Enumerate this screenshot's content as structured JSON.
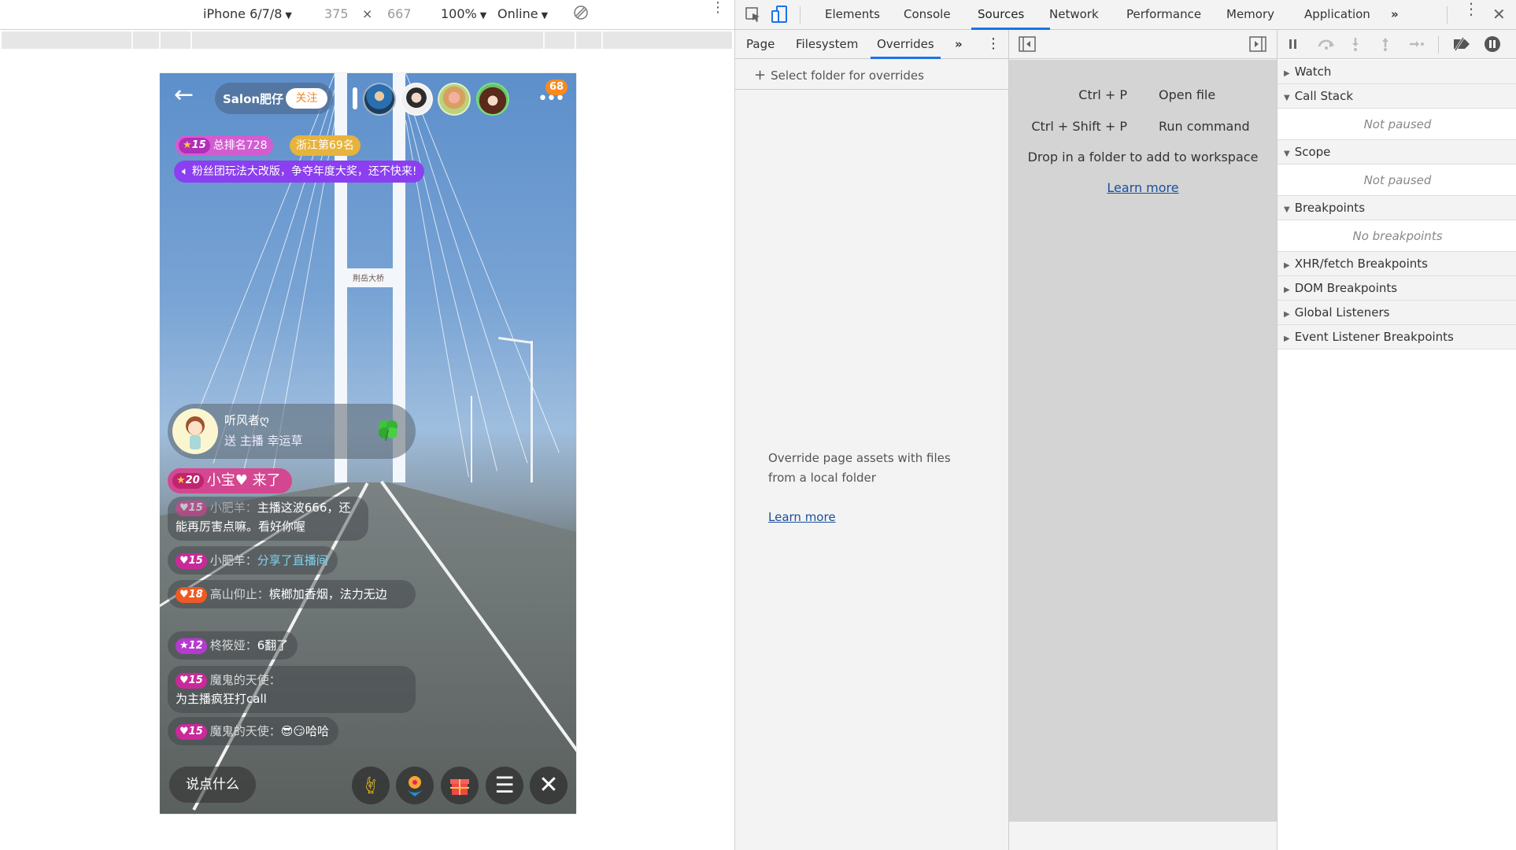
{
  "device_toolbar": {
    "device": "iPhone 6/7/8",
    "width": "375",
    "times": "×",
    "height": "667",
    "zoom": "100%",
    "network": "Online"
  },
  "phone": {
    "anchor_name": "Salon肥仔",
    "follow_label": "关注",
    "viewer_count": "68",
    "more_icon": "•••",
    "rank": {
      "level": "15",
      "text": "总排名728"
    },
    "region_rank": "浙江第69名",
    "notice": "粉丝团玩法大改版，争夺年度大奖，还不快来!",
    "bridge_sign": "荆岳大桥",
    "gift_banner": {
      "user": "听风者ღ",
      "text": "送 主播 幸运草"
    },
    "entrance": {
      "level": "20",
      "text": "小宝♥ 来了"
    },
    "chat": [
      {
        "level": "15",
        "badge_color": "#e0409a",
        "name": "小肥羊：",
        "text": "主播这波666，还能再厉害点嘛。看好你喔",
        "kind": "text"
      },
      {
        "level": "15",
        "badge_color": "#c92a9a",
        "name": "小肥羊：",
        "text": "分享了直播间",
        "kind": "share"
      },
      {
        "level": "18",
        "badge_color": "#ef5a22",
        "name": "高山仰止：",
        "text": "槟榔加香烟，法力无边",
        "kind": "text"
      },
      {
        "level": "12",
        "badge_color": "#b53ad0",
        "name": "柊筱娅：",
        "text": "6翻了",
        "kind": "text"
      },
      {
        "level": "15",
        "badge_color": "#c92a9a",
        "name": "魔鬼的天使：",
        "text": "为主播疯狂打call",
        "kind": "text"
      },
      {
        "level": "15",
        "badge_color": "#c92a9a",
        "name": "魔鬼的天使：",
        "text": "😎😏哈哈",
        "kind": "text"
      }
    ],
    "say_placeholder": "说点什么",
    "bottom_icons": [
      "rock-hand-icon",
      "flower-icon",
      "gift-icon",
      "menu-icon",
      "close-icon"
    ]
  },
  "devtools": {
    "tabs": [
      "Elements",
      "Console",
      "Sources",
      "Network",
      "Performance",
      "Memory",
      "Application"
    ],
    "active_tab": "Sources",
    "more_tabs": "»",
    "navigator": {
      "tabs": [
        "Page",
        "Filesystem",
        "Overrides"
      ],
      "active_tab": "Overrides",
      "more_tabs": "»",
      "select_folder": "Select folder for overrides",
      "description": "Override page assets with files from a local folder",
      "learn_more": "Learn more"
    },
    "editor": {
      "shortcuts": [
        {
          "keys": "Ctrl + P",
          "action": "Open file"
        },
        {
          "keys": "Ctrl + Shift + P",
          "action": "Run command"
        }
      ],
      "drop_hint": "Drop in a folder to add to workspace",
      "learn_more": "Learn more"
    },
    "sidebar": {
      "sections": [
        {
          "title": "Watch",
          "expanded": false
        },
        {
          "title": "Call Stack",
          "expanded": true,
          "body": "Not paused"
        },
        {
          "title": "Scope",
          "expanded": true,
          "body": "Not paused"
        },
        {
          "title": "Breakpoints",
          "expanded": true,
          "body": "No breakpoints"
        },
        {
          "title": "XHR/fetch Breakpoints",
          "expanded": false
        },
        {
          "title": "DOM Breakpoints",
          "expanded": false
        },
        {
          "title": "Global Listeners",
          "expanded": false
        },
        {
          "title": "Event Listener Breakpoints",
          "expanded": false
        }
      ]
    }
  },
  "colors": {
    "accent_blue": "#1a73e8",
    "follow_orange": "#f08a24",
    "count_badge": "#f88a1e",
    "rank_pill": "#d45cd2",
    "region_pill": "#e6b33c",
    "notice_pill": "#8b3ff0",
    "entrance_pill": "#dc3c8c",
    "link": "#1a4f9c"
  }
}
